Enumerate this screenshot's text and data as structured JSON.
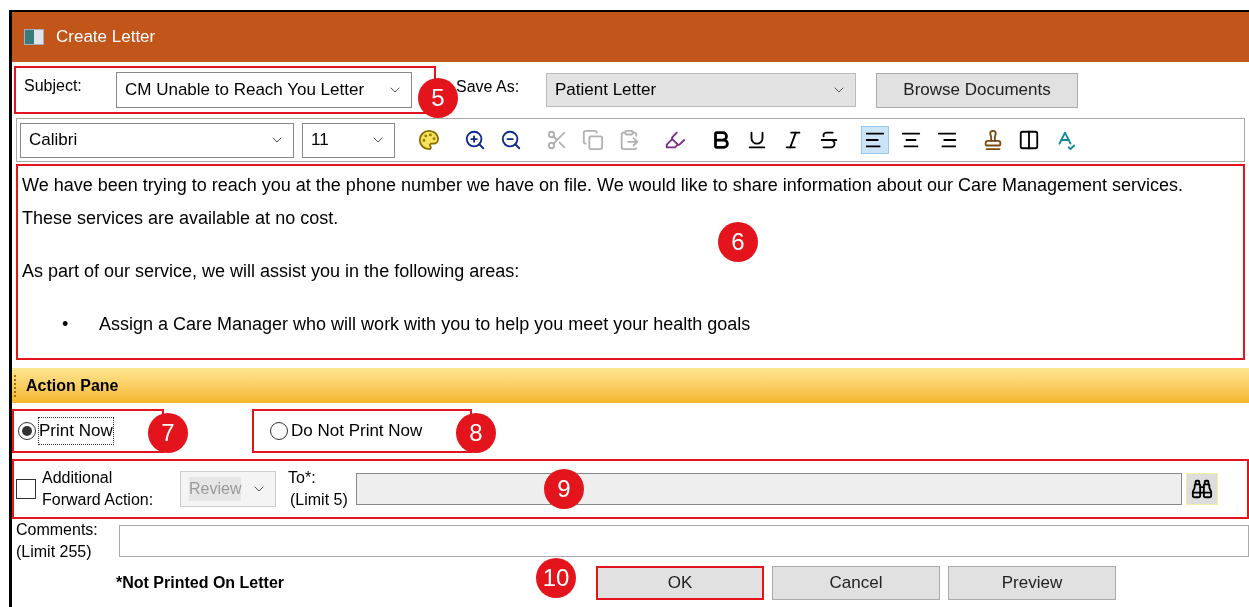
{
  "window": {
    "title": "Create Letter"
  },
  "subject": {
    "label": "Subject:",
    "value": "CM Unable to Reach You Letter",
    "callout": "5"
  },
  "save_as": {
    "label": "Save As:",
    "value": "Patient Letter"
  },
  "browse_button": {
    "label": "Browse Documents"
  },
  "font": {
    "value": "Calibri"
  },
  "font_size": {
    "value": "11"
  },
  "tools": [
    {
      "kind": "palette",
      "disabled": false
    },
    {
      "kind": "zoom-in",
      "disabled": false
    },
    {
      "kind": "zoom-out",
      "disabled": false
    },
    {
      "kind": "cut",
      "disabled": true
    },
    {
      "kind": "copy",
      "disabled": true
    },
    {
      "kind": "paste",
      "disabled": true
    },
    {
      "kind": "highlighter",
      "disabled": false
    },
    {
      "kind": "bold",
      "disabled": false
    },
    {
      "kind": "underline",
      "disabled": false
    },
    {
      "kind": "italic",
      "disabled": false
    },
    {
      "kind": "strikethrough",
      "disabled": false
    },
    {
      "kind": "align-left",
      "disabled": false,
      "selected": true
    },
    {
      "kind": "align-center",
      "disabled": false,
      "selected": false
    },
    {
      "kind": "align-right",
      "disabled": false,
      "selected": false
    },
    {
      "kind": "stamp",
      "disabled": false
    },
    {
      "kind": "insert-field",
      "disabled": false
    },
    {
      "kind": "spellcheck",
      "disabled": false
    }
  ],
  "editor": {
    "callout": "6",
    "paragraphs": [
      {
        "kind": "text",
        "text": "We have been trying to reach you at the phone number we have on file.  We would like to share information about our Care Management services.  These services are available at no cost."
      },
      {
        "kind": "text",
        "text": "As part of our service, we will assist you in the following areas:"
      },
      {
        "kind": "bullet",
        "marker": "•",
        "text": "Assign a Care Manager who will work with you to help you meet your health goals"
      }
    ]
  },
  "action_pane": {
    "title": "Action Pane"
  },
  "print_options": [
    {
      "label": "Print Now",
      "selected": true,
      "focused": true,
      "callout": "7"
    },
    {
      "label": "Do Not Print Now",
      "selected": false,
      "focused": false,
      "callout": "8"
    }
  ],
  "forward": {
    "label": "Additional Forward Action:",
    "checked": false,
    "action": {
      "value": "Review",
      "disabled": true
    },
    "to_label": "To*:",
    "to_limit": "(Limit 5)",
    "callout": "9"
  },
  "comments": {
    "label": "Comments:",
    "limit": "(Limit 255)"
  },
  "footnote": "*Not Printed On Letter",
  "buttons": [
    {
      "label": "OK",
      "callout": "10"
    },
    {
      "label": "Cancel"
    },
    {
      "label": "Preview"
    }
  ]
}
